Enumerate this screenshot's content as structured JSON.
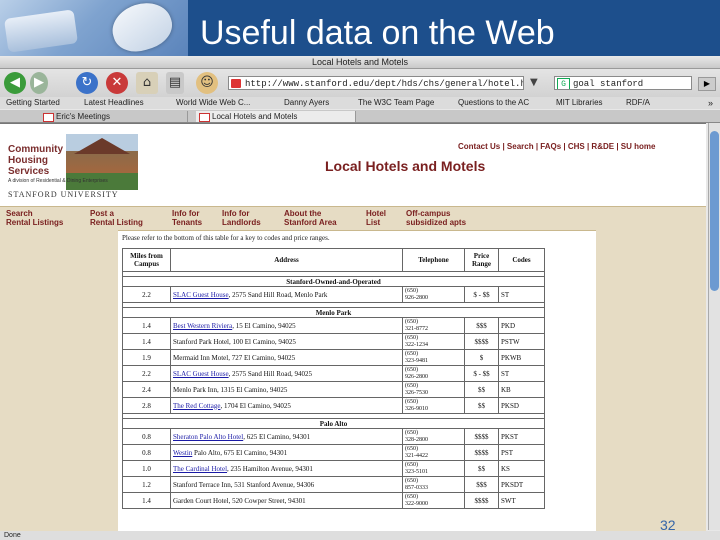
{
  "slide": {
    "title": "Useful data on the Web",
    "page_number": "32"
  },
  "browser": {
    "window_title": "Local Hotels and Motels",
    "url": "http://www.stanford.edu/dept/hds/chs/general/hotel.html",
    "search_query": "goal stanford",
    "status": "Done",
    "bookmarks": [
      "Getting Started",
      "Latest Headlines",
      "World Wide Web C...",
      "Danny Ayers",
      "The W3C Team Page",
      "Questions to the AC",
      "MIT Libraries",
      "RDF/A"
    ],
    "tabs": [
      {
        "label": "Eric's Meetings",
        "active": false
      },
      {
        "label": "Local Hotels and Motels",
        "active": true
      }
    ]
  },
  "page": {
    "logo_lines": [
      "Community",
      "Housing",
      "Services"
    ],
    "division_text": "A division of Residential & Dining Enterprises",
    "university": "STANFORD UNIVERSITY",
    "top_links": "Contact Us | Search | FAQs | CHS | R&DE | SU home",
    "heading": "Local Hotels and Motels",
    "nav": [
      {
        "line1": "Search",
        "line2": "Rental Listings"
      },
      {
        "line1": "Post a",
        "line2": "Rental Listing"
      },
      {
        "line1": "Info for",
        "line2": "Tenants"
      },
      {
        "line1": "Info for",
        "line2": "Landlords"
      },
      {
        "line1": "About the",
        "line2": "Stanford Area"
      },
      {
        "line1": "Hotel",
        "line2": "List"
      },
      {
        "line1": "Off-campus",
        "line2": "subsidized apts"
      }
    ],
    "note": "Please refer to the bottom of this table for a key to codes and price ranges.",
    "table": {
      "headers": {
        "miles": "Miles from Campus",
        "address": "Address",
        "telephone": "Telephone",
        "price": "Price Range",
        "codes": "Codes"
      },
      "sections": [
        {
          "name": "Stanford-Owned-and-Operated",
          "rows": [
            {
              "miles": "2.2",
              "name": "SLAC Guest House",
              "linked": true,
              "address": ", 2575 Sand Hill Road, Menlo Park",
              "phone1": "(650)",
              "phone2": "926-2800",
              "price": "$ - $$",
              "codes": "ST"
            }
          ]
        },
        {
          "name": "Menlo Park",
          "rows": [
            {
              "miles": "1.4",
              "name": "Best Western Riviera",
              "linked": true,
              "address": ", 15 El Camino, 94025",
              "phone1": "(650)",
              "phone2": "321-8772",
              "price": "$$$",
              "codes": "PKD"
            },
            {
              "miles": "1.4",
              "name": "Stanford Park Hotel",
              "linked": false,
              "address": ", 100 El Camino, 94025",
              "phone1": "(650)",
              "phone2": "322-1234",
              "price": "$$$$",
              "codes": "PSTW"
            },
            {
              "miles": "1.9",
              "name": "Mermaid Inn Motel",
              "linked": false,
              "address": ", 727 El Camino, 94025",
              "phone1": "(650)",
              "phone2": "323-9481",
              "price": "$",
              "codes": "PKWB"
            },
            {
              "miles": "2.2",
              "name": "SLAC Guest House",
              "linked": true,
              "address": ", 2575 Sand Hill Road, 94025",
              "phone1": "(650)",
              "phone2": "926-2800",
              "price": "$ - $$",
              "codes": "ST"
            },
            {
              "miles": "2.4",
              "name": "Menlo Park Inn",
              "linked": false,
              "address": ", 1315 El Camino, 94025",
              "phone1": "(650)",
              "phone2": "326-7530",
              "price": "$$",
              "codes": "KB"
            },
            {
              "miles": "2.8",
              "name": "The Red Cottage",
              "linked": true,
              "address": ", 1704 El Camino, 94025",
              "phone1": "(650)",
              "phone2": "326-9010",
              "price": "$$",
              "codes": "PKSD"
            }
          ]
        },
        {
          "name": "Palo Alto",
          "rows": [
            {
              "miles": "0.8",
              "name": "Sheraton Palo Alto Hotel",
              "linked": true,
              "address": ", 625 El Camino, 94301",
              "phone1": "(650)",
              "phone2": "328-2800",
              "price": "$$$$",
              "codes": "PKST"
            },
            {
              "miles": "0.8",
              "name": "Westin",
              "linked": true,
              "address": " Palo Alto, 675 El Camino, 94301",
              "phone1": "(650)",
              "phone2": "321-4422",
              "price": "$$$$",
              "codes": "PST"
            },
            {
              "miles": "1.0",
              "name": "The Cardinal Hotel",
              "linked": true,
              "address": ", 235 Hamilton Avenue, 94301",
              "phone1": "(650)",
              "phone2": "323-5101",
              "price": "$$",
              "codes": "KS"
            },
            {
              "miles": "1.2",
              "name": "Stanford Terrace Inn",
              "linked": false,
              "address": ", 531 Stanford Avenue, 94306",
              "phone1": "(650)",
              "phone2": "857-0333",
              "price": "$$$",
              "codes": "PKSDT"
            },
            {
              "miles": "1.4",
              "name": "Garden Court Hotel",
              "linked": false,
              "address": ", 520 Cowper Street, 94301",
              "phone1": "(650)",
              "phone2": "322-9000",
              "price": "$$$$",
              "codes": "SWT"
            }
          ]
        }
      ]
    }
  }
}
